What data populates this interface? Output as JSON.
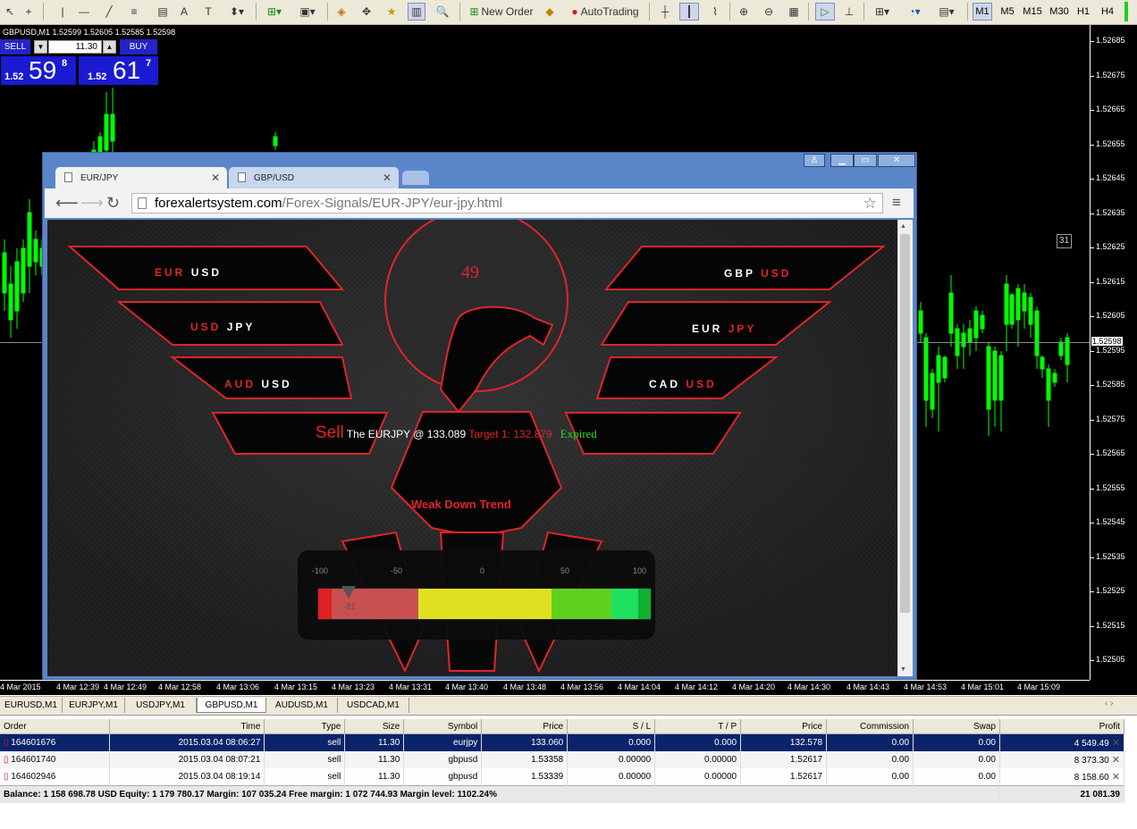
{
  "toolbar": {
    "new_order": "New Order",
    "auto_trading": "AutoTrading",
    "timeframes": [
      "M1",
      "M5",
      "M15",
      "M30",
      "H1",
      "H4"
    ]
  },
  "chart": {
    "title": "GBPUSD,M1  1.52599 1.52605 1.52585 1.52598",
    "bid_label": "1.52598",
    "price_ticks": [
      "1.52685",
      "1.52675",
      "1.52665",
      "1.52655",
      "1.52645",
      "1.52635",
      "1.52625",
      "1.52615",
      "1.52605",
      "1.52595",
      "1.52585",
      "1.52575",
      "1.52565",
      "1.52555",
      "1.52545",
      "1.52535",
      "1.52525",
      "1.52515",
      "1.52505"
    ],
    "time_ticks": [
      "4 Mar 2015",
      "4 Mar 12:39",
      "4 Mar 12:49",
      "4 Mar 12:58",
      "4 Mar 13:06",
      "4 Mar 13:15",
      "4 Mar 13:23",
      "4 Mar 13:31",
      "4 Mar 13:40",
      "4 Mar 13:48",
      "4 Mar 13:56",
      "4 Mar 14:04",
      "4 Mar 14:12",
      "4 Mar 14:20",
      "4 Mar 14:30",
      "4 Mar 14:43",
      "4 Mar 14:53",
      "4 Mar 15:01",
      "4 Mar 15:09"
    ],
    "period_sep_label": "31",
    "colors": {
      "candle": "#00ff00",
      "background": "#000000"
    }
  },
  "one_click": {
    "sell": "SELL",
    "buy": "BUY",
    "lot": "11.30",
    "sell_prefix": "1.52",
    "sell_big": "59",
    "sell_sup": "8",
    "buy_prefix": "1.52",
    "buy_big": "61",
    "buy_sup": "7"
  },
  "browser": {
    "tabs": [
      {
        "label": "EUR/JPY"
      },
      {
        "label": "GBP/USD"
      }
    ],
    "url_host": "forexalertsystem.com",
    "url_path": "/Forex-Signals/EUR-JPY/eur-jpy.html"
  },
  "signal_page": {
    "counter": "49",
    "pairs": [
      {
        "a": "EUR",
        "b": "USD"
      },
      {
        "a": "USD",
        "b": "JPY"
      },
      {
        "a": "AUD",
        "b": "USD"
      },
      {
        "a": "GBP",
        "b": "USD"
      },
      {
        "a": "EUR",
        "b": "JPY"
      },
      {
        "a": "CAD",
        "b": "USD"
      }
    ],
    "signal_action": "Sell",
    "signal_text": "The EURJPY @ 133.089",
    "target_text": "Target 1: 132.879",
    "status_text": "Expired",
    "trend": "Weak Down Trend",
    "gauge_ticks": [
      "-100",
      "-50",
      "0",
      "50",
      "100"
    ],
    "gauge_value": -81,
    "gauge_value_label": "-81",
    "colors": {
      "accent": "#e0242a",
      "expired": "#22dd22"
    }
  },
  "chart_tabs": [
    "EURUSD,M1",
    "EURJPY,M1",
    "USDJPY,M1",
    "GBPUSD,M1",
    "AUDUSD,M1",
    "USDCAD,M1"
  ],
  "terminal": {
    "headers": [
      "Order",
      "Time",
      "Type",
      "Size",
      "Symbol",
      "Price",
      "S / L",
      "T / P",
      "Price",
      "Commission",
      "Swap",
      "Profit"
    ],
    "rows": [
      [
        "164601676",
        "2015.03.04 08:06:27",
        "sell",
        "11.30",
        "eurjpy",
        "133.060",
        "0.000",
        "0.000",
        "132.578",
        "0.00",
        "0.00",
        "4 549.49"
      ],
      [
        "164601740",
        "2015.03.04 08:07:21",
        "sell",
        "11.30",
        "gbpusd",
        "1.53358",
        "0.00000",
        "0.00000",
        "1.52617",
        "0.00",
        "0.00",
        "8 373.30"
      ],
      [
        "164602946",
        "2015.03.04 08:19:14",
        "sell",
        "11.30",
        "gbpusd",
        "1.53339",
        "0.00000",
        "0.00000",
        "1.52617",
        "0.00",
        "0.00",
        "8 158.60"
      ]
    ],
    "balance_line": "Balance: 1 158 698.78 USD  Equity: 1 179 780.17  Margin: 107 035.24  Free margin: 1 072 744.93  Margin level: 1102.24%",
    "total_profit": "21 081.39"
  }
}
